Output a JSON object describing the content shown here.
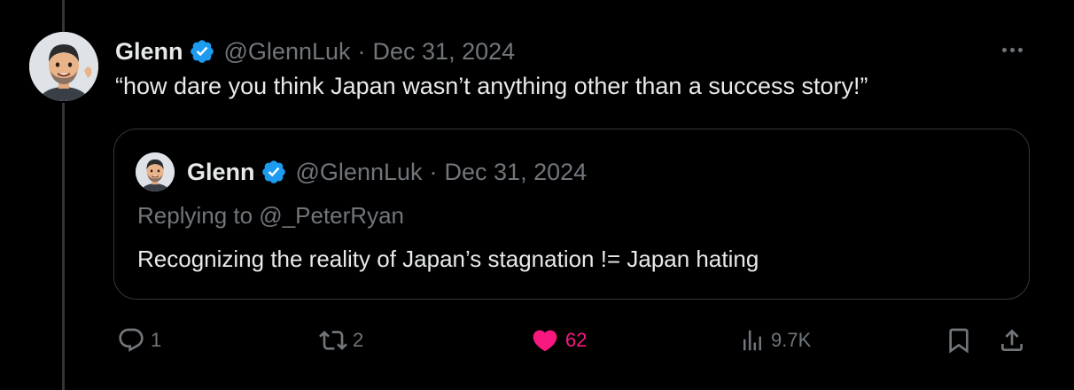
{
  "tweet": {
    "author_name": "Glenn",
    "handle": "@GlennLuk",
    "separator": "·",
    "date": "Dec 31, 2024",
    "text": "“how dare you think Japan wasn’t anything other than a success story!”",
    "avatar_icon": "memoji-avatar"
  },
  "quote": {
    "author_name": "Glenn",
    "handle": "@GlennLuk",
    "separator": "·",
    "date": "Dec 31, 2024",
    "replying_to": "Replying to @_PeterRyan",
    "text": "Recognizing the reality of Japan’s stagnation != Japan hating"
  },
  "actions": {
    "replies": "1",
    "reposts": "2",
    "likes": "62",
    "views": "9.7K"
  },
  "colors": {
    "background": "#000000",
    "text_primary": "#e7e9ea",
    "text_secondary": "#71767b",
    "border": "#333639",
    "verified_blue": "#1d9bf0",
    "like_pink": "#f91880"
  }
}
